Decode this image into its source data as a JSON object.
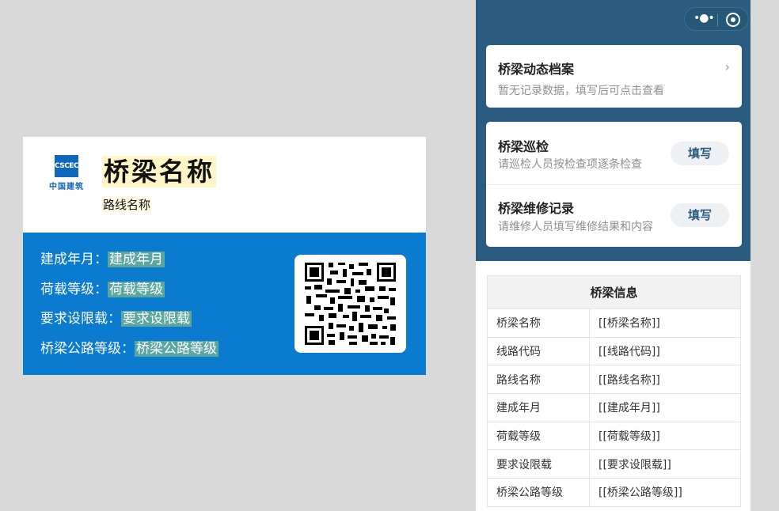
{
  "card": {
    "logo_mark": "CSCEC",
    "logo_text": "中国建筑",
    "title": "桥梁名称",
    "subtitle": "路线名称",
    "rows": [
      {
        "label": "建成年月：",
        "value": "建成年月"
      },
      {
        "label": "荷载等级：",
        "value": "荷载等级"
      },
      {
        "label": "要求设限载：",
        "value": "要求设限载"
      },
      {
        "label": "桥梁公路等级：",
        "value": "桥梁公路等级"
      }
    ],
    "qr_icon": "qr-code"
  },
  "phone": {
    "capsule": {
      "menu_icon": "more-dots-icon",
      "close_icon": "target-circle-icon"
    },
    "archive": {
      "title": "桥梁动态档案",
      "desc": "暂无记录数据，填写后可点击查看",
      "icon": "chevron-right-icon"
    },
    "inspection": {
      "title": "桥梁巡检",
      "desc": "请巡检人员按检查项逐条检查",
      "button": "填写"
    },
    "maintenance": {
      "title": "桥梁维修记录",
      "desc": "请维修人员填写维修结果和内容",
      "button": "填写"
    },
    "table": {
      "header": "桥梁信息",
      "rows": [
        {
          "key": "桥梁名称",
          "value": "[[桥梁名称]]"
        },
        {
          "key": "线路代码",
          "value": "[[线路代码]]"
        },
        {
          "key": "路线名称",
          "value": "[[路线名称]]"
        },
        {
          "key": "建成年月",
          "value": "[[建成年月]]"
        },
        {
          "key": "荷载等级",
          "value": "[[荷载等级]]"
        },
        {
          "key": "要求设限载",
          "value": "[[要求设限载]]"
        },
        {
          "key": "桥梁公路等级",
          "value": "[[桥梁公路等级]]"
        }
      ]
    }
  },
  "colors": {
    "card_blue": "#0a7bce",
    "phone_header": "#2b5c80",
    "highlight": "#5ba6a0"
  }
}
